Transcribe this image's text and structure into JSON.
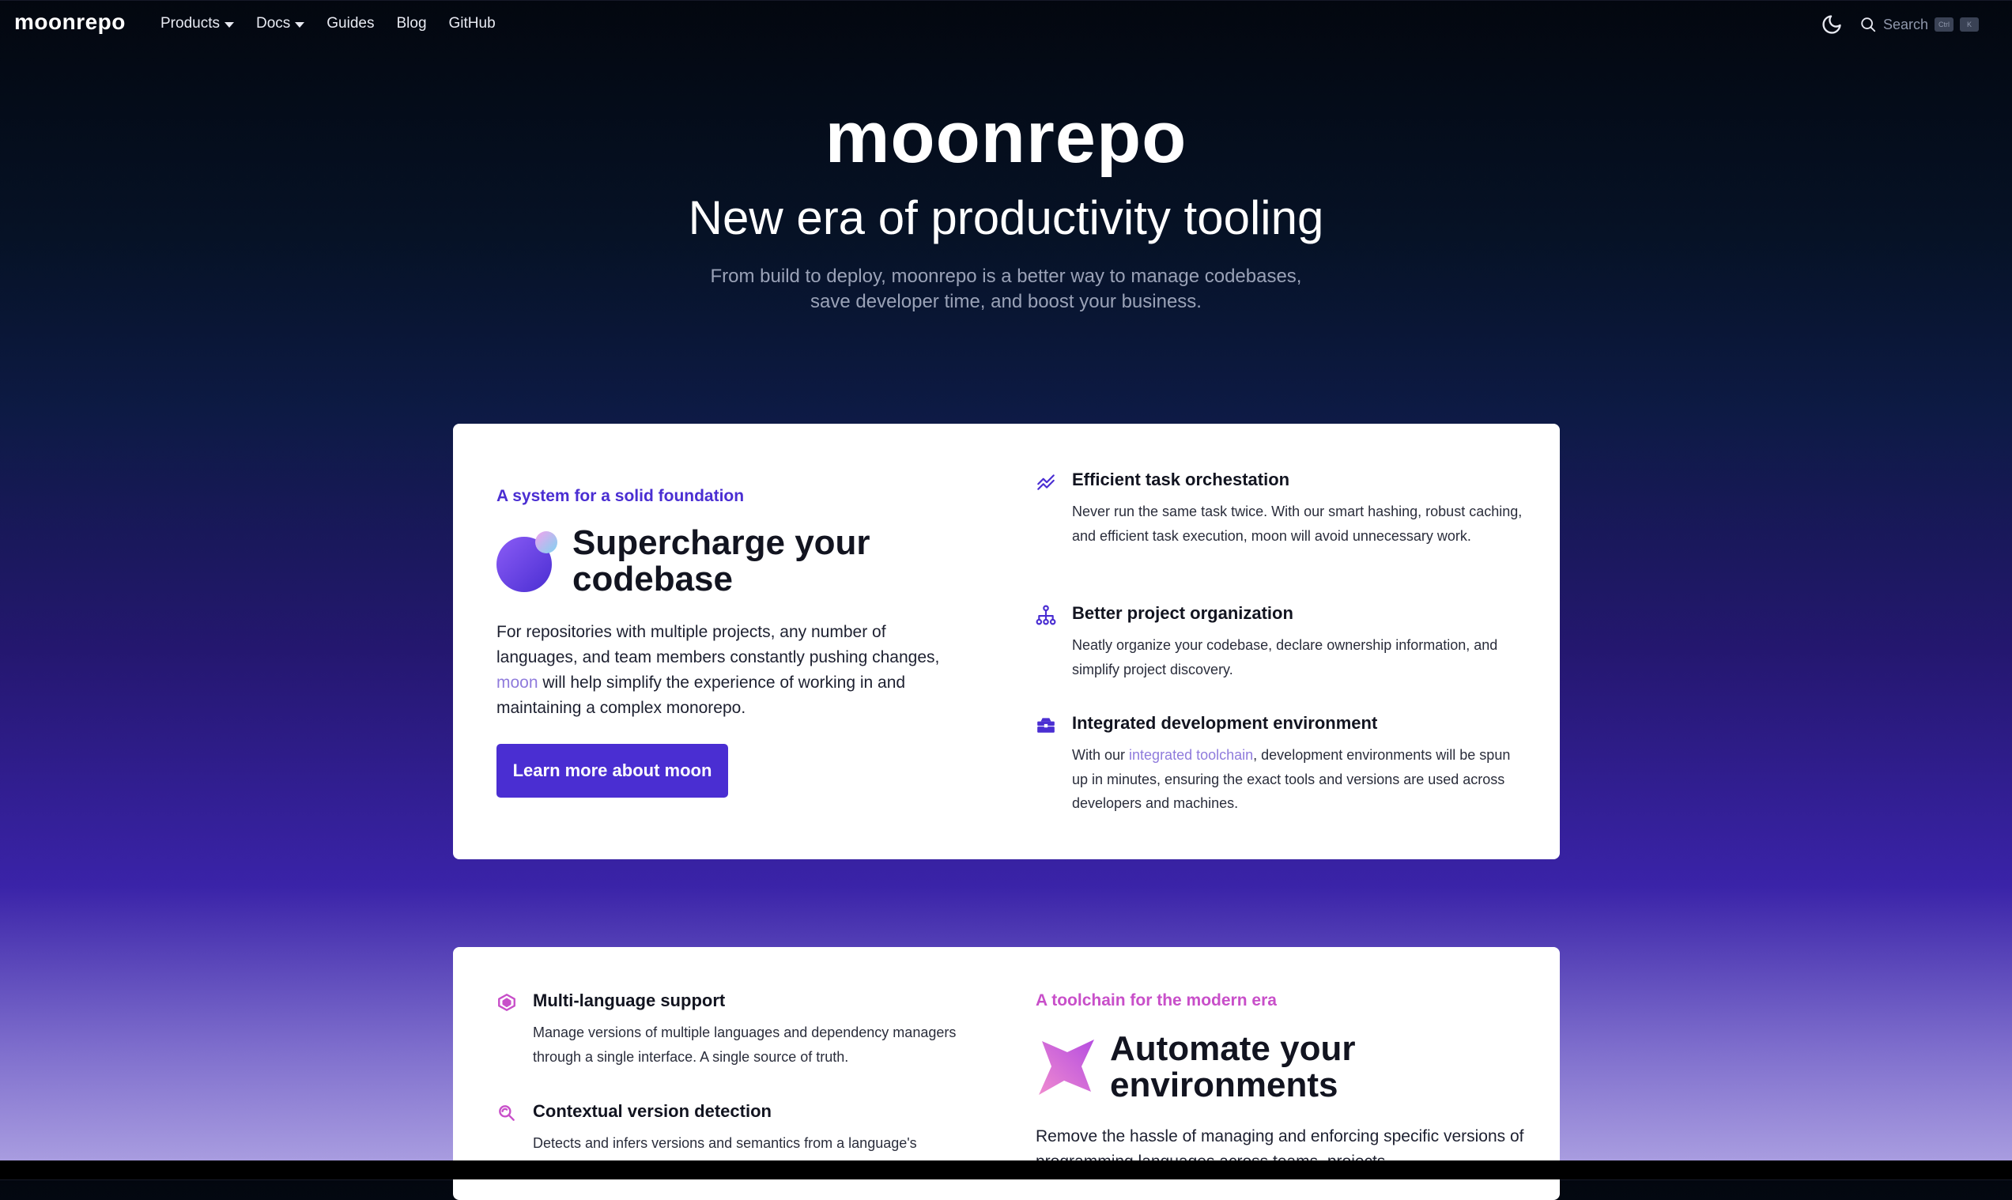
{
  "nav": {
    "logo": "moonrepo",
    "links": [
      {
        "label": "Products",
        "dropdown": true
      },
      {
        "label": "Docs",
        "dropdown": true
      },
      {
        "label": "Guides"
      },
      {
        "label": "Blog"
      },
      {
        "label": "GitHub"
      }
    ],
    "search": {
      "placeholder": "Search",
      "shortcut": [
        "Ctrl",
        "K"
      ]
    },
    "theme_icon": "moon-icon"
  },
  "hero": {
    "logo": "moonrepo",
    "title": "New era of productivity tooling",
    "subtitle": "From build to deploy, moonrepo is a better way to manage codebases, save developer time, and boost your business."
  },
  "section_moon": {
    "eyebrow": "A system for a solid foundation",
    "title": "Supercharge your codebase",
    "description_prefix": "For repositories with multiple projects, any number of languages, and team members constantly pushing changes, ",
    "description_link": "moon",
    "description_suffix": " will help simplify the experience of working in and maintaining a complex monorepo.",
    "cta": "Learn more about moon",
    "features": [
      {
        "icon": "trend-chart-icon",
        "title": "Efficient task orchestation",
        "desc": "Never run the same task twice. With our smart hashing, robust caching, and efficient task execution, moon will avoid unnecessary work."
      },
      {
        "icon": "project-tree-icon",
        "title": "Better project organization",
        "desc": "Neatly organize your codebase, declare ownership information, and simplify project discovery."
      },
      {
        "icon": "toolbox-icon",
        "title": "Integrated development environment",
        "desc_prefix": "With our ",
        "desc_link": "integrated toolchain",
        "desc_suffix": ", development environments will be spun up in minutes, ensuring the exact tools and versions are used across developers and machines."
      }
    ],
    "accent_color": "#4a2ed2"
  },
  "section_proto": {
    "eyebrow": "A toolchain for the modern era",
    "title": "Automate your environments",
    "description": "Remove the hassle of managing and enforcing specific versions of programming languages across teams, projects,",
    "features": [
      {
        "icon": "layers-icon",
        "title": "Multi-language support",
        "desc": "Manage versions of multiple languages and dependency managers through a single interface. A single source of truth."
      },
      {
        "icon": "search-refresh-icon",
        "title": "Contextual version detection",
        "desc": "Detects and infers versions and semantics from a language's"
      }
    ],
    "accent_color": "#c84fc9"
  }
}
